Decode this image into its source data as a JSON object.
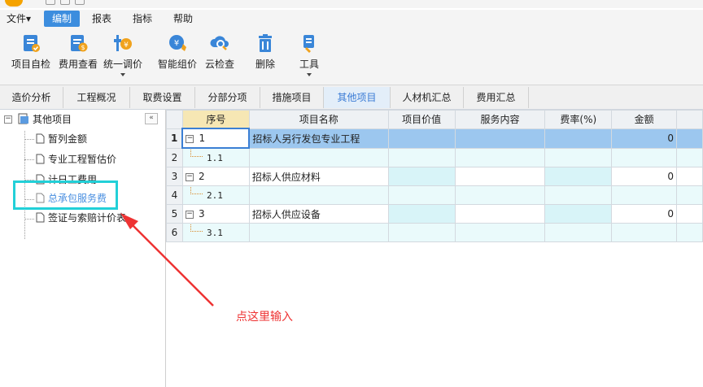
{
  "menu": {
    "items": [
      {
        "label": "文件▾"
      },
      {
        "label": "编制",
        "active": true
      },
      {
        "label": "报表"
      },
      {
        "label": "指标"
      },
      {
        "label": "帮助"
      }
    ]
  },
  "ribbon": {
    "buttons": [
      {
        "label": "项目自检",
        "icon": "project-check-icon"
      },
      {
        "label": "费用查看",
        "icon": "fee-view-icon"
      },
      {
        "label": "统一调价",
        "icon": "unified-price-icon",
        "has_dropdown": true
      },
      {
        "label": "智能组价",
        "icon": "smart-pricing-icon"
      },
      {
        "label": "云检查",
        "icon": "cloud-check-icon"
      },
      {
        "label": "删除",
        "icon": "trash-icon"
      },
      {
        "label": "工具",
        "icon": "tools-icon",
        "has_dropdown": true
      }
    ]
  },
  "tabs": [
    {
      "label": "造价分析"
    },
    {
      "label": "工程概况"
    },
    {
      "label": "取费设置"
    },
    {
      "label": "分部分项"
    },
    {
      "label": "措施项目"
    },
    {
      "label": "其他项目",
      "active": true
    },
    {
      "label": "人材机汇总"
    },
    {
      "label": "费用汇总"
    }
  ],
  "tree": {
    "root": "其他项目",
    "collapse_glyph": "«",
    "children": [
      "暂列金额",
      "专业工程暂估价",
      "计日工费用",
      "总承包服务费",
      "签证与索赔计价表"
    ],
    "highlighted": "总承包服务费"
  },
  "grid": {
    "headers": [
      "序号",
      "项目名称",
      "项目价值",
      "服务内容",
      "费率(%)",
      "金额"
    ],
    "rows": [
      {
        "n": "1",
        "code": "1",
        "name": "招标人另行发包专业工程",
        "amount": "0",
        "level": 1
      },
      {
        "n": "2",
        "code": "1.1",
        "name": "",
        "amount": "",
        "level": 2
      },
      {
        "n": "3",
        "code": "2",
        "name": "招标人供应材料",
        "amount": "0",
        "level": 1
      },
      {
        "n": "4",
        "code": "2.1",
        "name": "",
        "amount": "",
        "level": 2
      },
      {
        "n": "5",
        "code": "3",
        "name": "招标人供应设备",
        "amount": "0",
        "level": 1
      },
      {
        "n": "6",
        "code": "3.1",
        "name": "",
        "amount": "",
        "level": 2
      }
    ]
  },
  "annotation": {
    "text": "点这里输入",
    "color": "#e33333",
    "box_color": "#22d0d8"
  },
  "colors": {
    "accent": "#3c8dde",
    "selected_row": "#9cc7ef",
    "editable_cell": "#eafafb"
  }
}
